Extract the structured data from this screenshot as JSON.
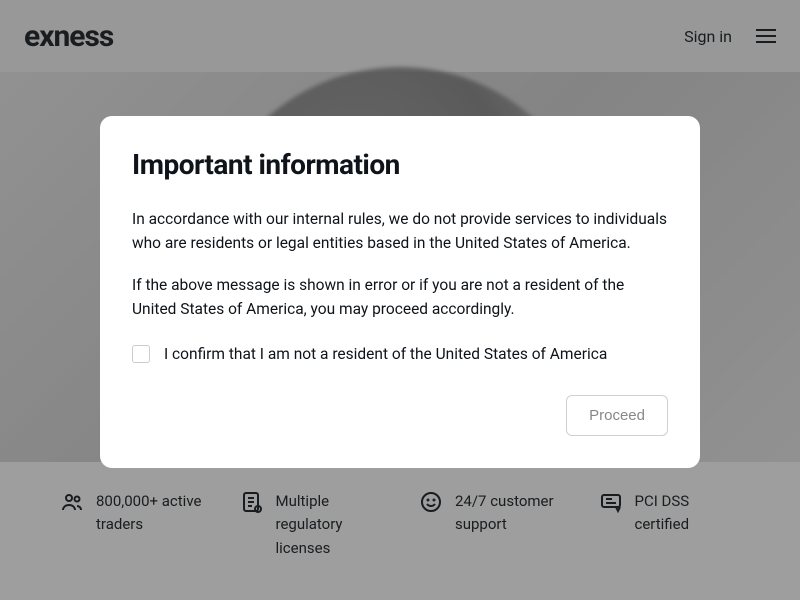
{
  "header": {
    "logo": "exness",
    "signin": "Sign in"
  },
  "features": [
    {
      "icon": "users",
      "text": "800,000+ active traders"
    },
    {
      "icon": "license",
      "text": "Multiple regulatory licenses"
    },
    {
      "icon": "support",
      "text": "24/7 customer support"
    },
    {
      "icon": "pci",
      "text": "PCI DSS certified"
    }
  ],
  "modal": {
    "title": "Important information",
    "p1": "In accordance with our internal rules, we do not provide services to individuals who are residents or legal entities based in the United States of America.",
    "p2": "If the above message is shown in error or if you are not a resident of the United States of America, you may proceed accordingly.",
    "confirm_label": "I confirm that I am not a resident of the United States of America",
    "proceed_label": "Proceed"
  }
}
